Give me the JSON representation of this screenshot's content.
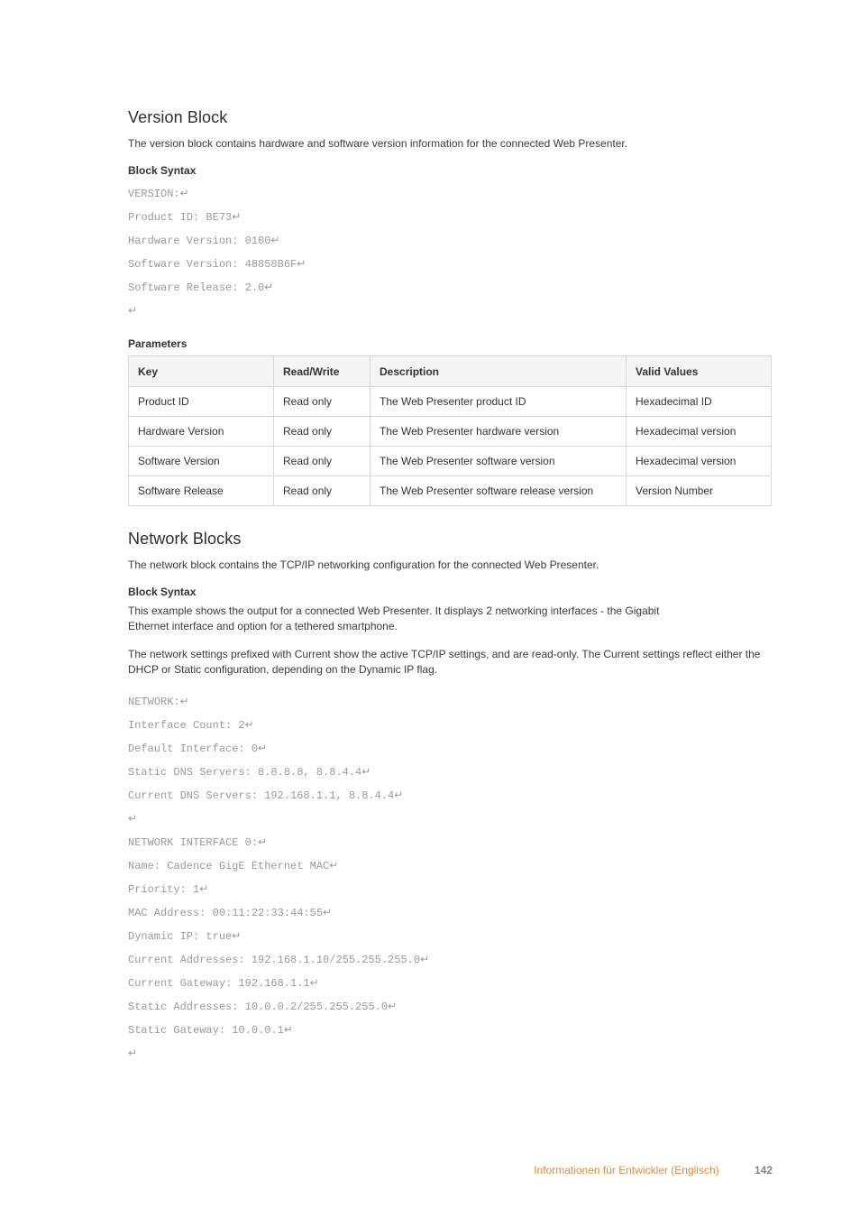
{
  "section1": {
    "title": "Version Block",
    "intro": "The version block contains hardware and software version information for the connected Web Presenter.",
    "blockSyntaxHeading": "Block Syntax",
    "code": [
      "VERSION:",
      "Product ID: BE73",
      "Hardware Version: 0100",
      "Software Version: 48858B6F",
      "Software Release: 2.0",
      ""
    ],
    "paramsHeading": "Parameters",
    "table": {
      "headers": [
        "Key",
        "Read/Write",
        "Description",
        "Valid Values"
      ],
      "rows": [
        [
          "Product ID",
          "Read only",
          "The Web Presenter product ID",
          "Hexadecimal ID"
        ],
        [
          "Hardware Version",
          "Read only",
          "The Web Presenter hardware version",
          "Hexadecimal version"
        ],
        [
          "Software Version",
          "Read only",
          "The Web Presenter software version",
          "Hexadecimal version"
        ],
        [
          "Software Release",
          "Read only",
          "The Web Presenter software release version",
          "Version Number"
        ]
      ]
    }
  },
  "section2": {
    "title": "Network Blocks",
    "intro": "The network block contains the TCP/IP networking configuration for the connected Web Presenter.",
    "blockSyntaxHeading": "Block Syntax",
    "p1": "This example shows the output for a connected Web Presenter. It displays 2 networking interfaces - the Gigabit Ethernet interface and option for a tethered smartphone.",
    "p2": "The network settings prefixed with Current show the active TCP/IP settings, and are read-only. The Current settings reflect either the DHCP or Static configuration, depending on the Dynamic IP flag.",
    "code": [
      "NETWORK:",
      "Interface Count: 2",
      "Default Interface: 0",
      "Static DNS Servers: 8.8.8.8, 8.8.4.4",
      "Current DNS Servers: 192.168.1.1, 8.8.4.4",
      "",
      "NETWORK INTERFACE 0:",
      "Name: Cadence GigE Ethernet MAC",
      "Priority: 1",
      "MAC Address: 00:11:22:33:44:55",
      "Dynamic IP: true",
      "Current Addresses: 192.168.1.10/255.255.255.0",
      "Current Gateway: 192.168.1.1",
      "Static Addresses: 10.0.0.2/255.255.255.0",
      "Static Gateway: 10.0.0.1",
      ""
    ]
  },
  "footer": {
    "sectionName": "Informationen für Entwickler (Englisch)",
    "pageNumber": "142"
  },
  "nlGlyph": "↵"
}
